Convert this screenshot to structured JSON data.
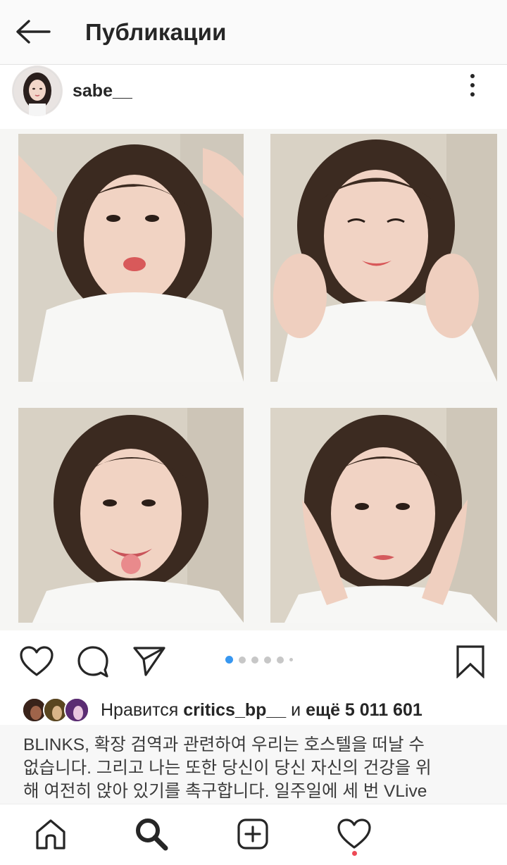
{
  "topbar": {
    "title": "Публикации",
    "back_icon": "arrow-left-icon"
  },
  "post": {
    "username": "sabe__",
    "more_icon": "more-vertical-icon",
    "carousel": {
      "count": 6,
      "active_index": 0
    }
  },
  "actions": {
    "like_icon": "heart-icon",
    "comment_icon": "comment-icon",
    "share_icon": "send-icon",
    "save_icon": "bookmark-icon"
  },
  "likes": {
    "prefix": "Нравится",
    "user": "critics_bp__",
    "conj": "и",
    "more_label": "ещё 5 011 601"
  },
  "caption": {
    "lines": [
      "BLINKS, 확장 검역과 관련하여 우리는 호스텔을 떠날 수",
      "없습니다. 그리고 나는 또한 당신이 당신 자신의 건강을 위",
      "해 여전히 앉아 있기를 촉구합니다. 일주일에 세 번 VLive"
    ]
  },
  "bottom_nav": {
    "items": [
      "home-icon",
      "search-icon",
      "new-post-icon",
      "activity-heart-icon"
    ]
  },
  "colors": {
    "accent": "#3897f0",
    "notification": "#ed4956",
    "text": "#262626"
  }
}
